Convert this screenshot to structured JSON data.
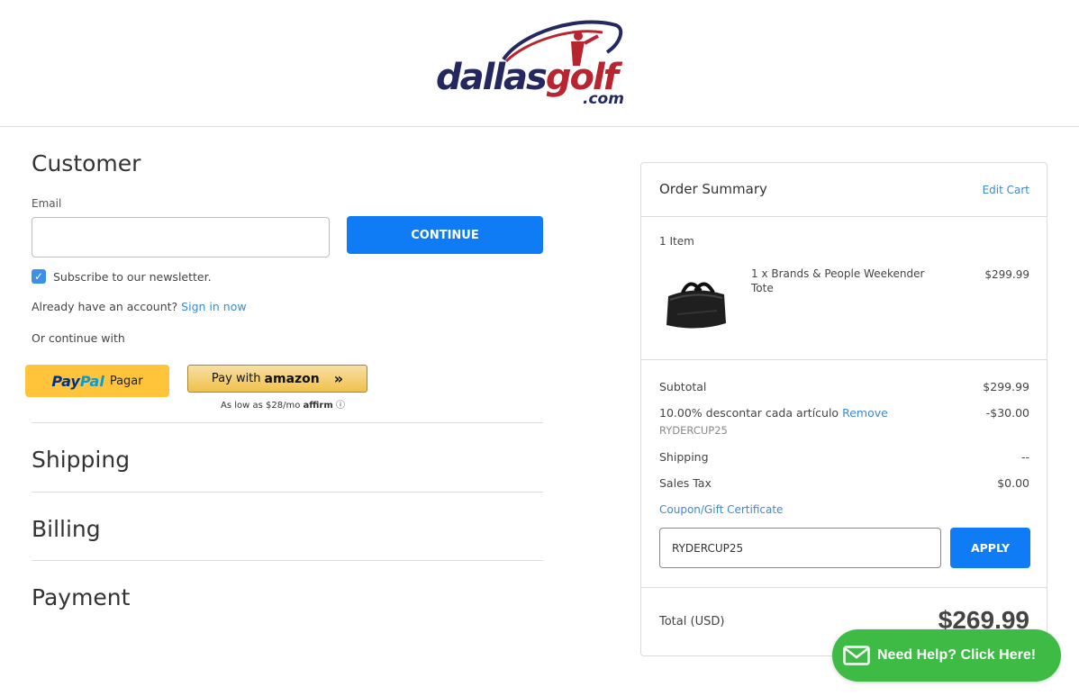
{
  "brand": {
    "logo_main": "dallas",
    "logo_accent": "golf",
    "logo_suffix": ".com"
  },
  "customer": {
    "title": "Customer",
    "email_label": "Email",
    "email_value": "",
    "continue_label": "CONTINUE",
    "newsletter_label": "Subscribe to our newsletter.",
    "newsletter_checked": true,
    "account_prompt": "Already have an account?",
    "sign_in_label": "Sign in now",
    "or_continue": "Or continue with"
  },
  "payment_buttons": {
    "paypal_logo_a": "Pay",
    "paypal_logo_b": "Pal",
    "paypal_label": "Pagar",
    "amazon_prefix": "Pay with",
    "amazon_logo": "amazon",
    "affirm_prefix": "As low as $28/mo",
    "affirm_brand": "affirm"
  },
  "steps": {
    "shipping": "Shipping",
    "billing": "Billing",
    "payment": "Payment"
  },
  "summary": {
    "title": "Order Summary",
    "edit_cart": "Edit Cart",
    "items_count": "1 Item",
    "product": {
      "name": "1 x Brands & People Weekender Tote",
      "price": "$299.99"
    },
    "subtotal_label": "Subtotal",
    "subtotal_value": "$299.99",
    "discount_label": "10.00% descontar cada artículo",
    "discount_remove": "Remove",
    "discount_value": "-$30.00",
    "discount_code": "RYDERCUP25",
    "shipping_label": "Shipping",
    "shipping_value": "--",
    "tax_label": "Sales Tax",
    "tax_value": "$0.00",
    "coupon_link": "Coupon/Gift Certificate",
    "coupon_value": "RYDERCUP25",
    "apply_label": "APPLY",
    "total_label": "Total (USD)",
    "total_value": "$269.99"
  },
  "help": {
    "label": "Need Help? Click Here!",
    "icon": "envelope-icon"
  },
  "colors": {
    "primary_button": "#0f7bf5",
    "link": "#3b8ad6",
    "help_green": "#3dbb44",
    "brand_navy": "#24285e",
    "brand_red": "#b8242f"
  }
}
